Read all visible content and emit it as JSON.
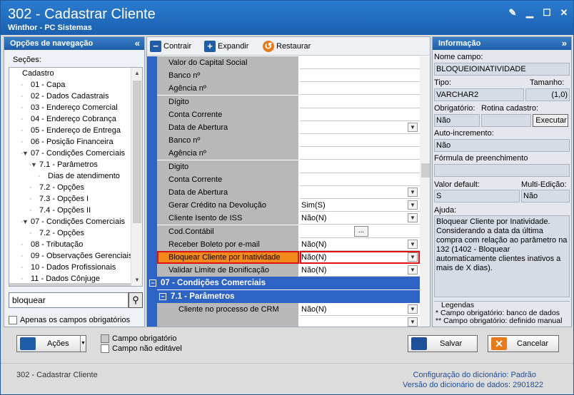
{
  "window": {
    "title": "302 - Cadastrar Cliente",
    "subtitle": "Winthor - PC Sistemas"
  },
  "nav": {
    "header": "Opções de navegação",
    "sections_label": "Seções:",
    "items": [
      {
        "label": "Cadastro",
        "indent": 0,
        "arrow": ""
      },
      {
        "label": "01 - Capa",
        "indent": 1,
        "arrow": ""
      },
      {
        "label": "02 - Dados Cadastrais",
        "indent": 1,
        "arrow": ""
      },
      {
        "label": "03 - Endereço Comercial",
        "indent": 1,
        "arrow": ""
      },
      {
        "label": "04 - Endereço Cobrança",
        "indent": 1,
        "arrow": ""
      },
      {
        "label": "05 - Endereço de Entrega",
        "indent": 1,
        "arrow": ""
      },
      {
        "label": "06 - Posição Financeira",
        "indent": 1,
        "arrow": ""
      },
      {
        "label": "07 - Condições Comerciais",
        "indent": 1,
        "arrow": "▼"
      },
      {
        "label": "7.1 - Parâmetros",
        "indent": 2,
        "arrow": "▼"
      },
      {
        "label": "Dias de atendimento",
        "indent": 3,
        "arrow": ""
      },
      {
        "label": "7.2 - Opções",
        "indent": 2,
        "arrow": ""
      },
      {
        "label": "7.3 - Opções I",
        "indent": 2,
        "arrow": ""
      },
      {
        "label": "7.4 - Opções II",
        "indent": 2,
        "arrow": ""
      },
      {
        "label": "07 - Condições Comerciais",
        "indent": 1,
        "arrow": "▼"
      },
      {
        "label": "7.2 - Opções",
        "indent": 2,
        "arrow": ""
      },
      {
        "label": "08 - Tributação",
        "indent": 1,
        "arrow": ""
      },
      {
        "label": "09 - Observações Gerenciais",
        "indent": 1,
        "arrow": ""
      },
      {
        "label": "10 - Dados Profissionais",
        "indent": 1,
        "arrow": ""
      },
      {
        "label": "11 - Dados Cônjuge",
        "indent": 1,
        "arrow": ""
      }
    ],
    "search_value": "bloquear",
    "only_required_label": "Apenas os campos obrigatórios"
  },
  "toolbar": {
    "collapse": "Contrair",
    "expand": "Expandir",
    "restore": "Restaurar"
  },
  "grid": {
    "rows": [
      {
        "label": "Valor do Capital Social",
        "value": "",
        "type": "text"
      },
      {
        "label": "Banco nº",
        "value": "",
        "type": "text"
      },
      {
        "label": "Agência nº",
        "value": "",
        "type": "text"
      },
      {
        "label": "Dígito",
        "value": "",
        "type": "text"
      },
      {
        "label": "Conta Corrente",
        "value": "",
        "type": "text"
      },
      {
        "label": "Data de Abertura",
        "value": "",
        "type": "dropdown"
      },
      {
        "label": "Banco nº",
        "value": "",
        "type": "text"
      },
      {
        "label": "Agência nº",
        "value": "",
        "type": "text"
      },
      {
        "label": "Digito",
        "value": "",
        "type": "text"
      },
      {
        "label": "Conta Corrente",
        "value": "",
        "type": "text"
      },
      {
        "label": "Data de Abertura",
        "value": "",
        "type": "dropdown"
      },
      {
        "label": "Gerar Crédito na Devolução",
        "value": "Sim(S)",
        "type": "dropdown"
      },
      {
        "label": "Cliente Isento de ISS",
        "value": "Não(N)",
        "type": "dropdown"
      },
      {
        "label": "Cod.Contábil",
        "value": "",
        "type": "ellipsis"
      },
      {
        "label": "Receber Boleto por e-mail",
        "value": "Não(N)",
        "type": "dropdown"
      },
      {
        "label": "Bloquear Cliente por Inatividade",
        "value": "Não(N)",
        "type": "dropdown",
        "highlight": true
      },
      {
        "label": "Validar Limite de Bonificação",
        "value": "Não(N)",
        "type": "dropdown"
      }
    ],
    "section1": "07 - Condições Comerciais",
    "section2": "7.1 - Parâmetros",
    "subrows": [
      {
        "label": "Cliente no processo de CRM",
        "value": "Não(N)",
        "type": "dropdown"
      },
      {
        "label": "",
        "value": "",
        "type": "dropdown"
      }
    ]
  },
  "info": {
    "header": "Informação",
    "field_name_label": "Nome campo:",
    "field_name": "BLOQUEIOINATIVIDADE",
    "type_label": "Tipo:",
    "type": "VARCHAR2",
    "size_label": "Tamanho:",
    "size": "(1,0)",
    "required_label": "Obrigatório:",
    "required": "Não",
    "routine_label": "Rotina cadastro:",
    "execute_label": "Executar",
    "autoinc_label": "Auto-incremento:",
    "autoinc": "Não",
    "formula_label": "Fórmula de preenchimento",
    "formula": "",
    "default_label": "Valor default:",
    "default": "S",
    "multi_label": "Multi-Edição:",
    "multi": "Não",
    "help_label": "Ajuda:",
    "help": "Bloquear Cliente por Inatividade. Considerando a data da última compra com relação ao parâmetro na 132 (1402 - Bloquear automaticamente clientes inativos a mais de X dias).",
    "legend_title": "Legendas",
    "legend1": "* Campo obrigatório: banco de dados",
    "legend2": "** Campo obrigatório: definido manual"
  },
  "bottom": {
    "actions_label": "Ações",
    "legend_required": "Campo obrigatório",
    "legend_readonly": "Campo não editável",
    "save_label": "Salvar",
    "cancel_label": "Cancelar"
  },
  "status": {
    "left": "302 - Cadastrar Cliente",
    "dict_config_label": "Configuração do dicionário:",
    "dict_config": "Padrão",
    "dict_version_label": "Versão do dicionário de dados:",
    "dict_version": "2901822"
  }
}
